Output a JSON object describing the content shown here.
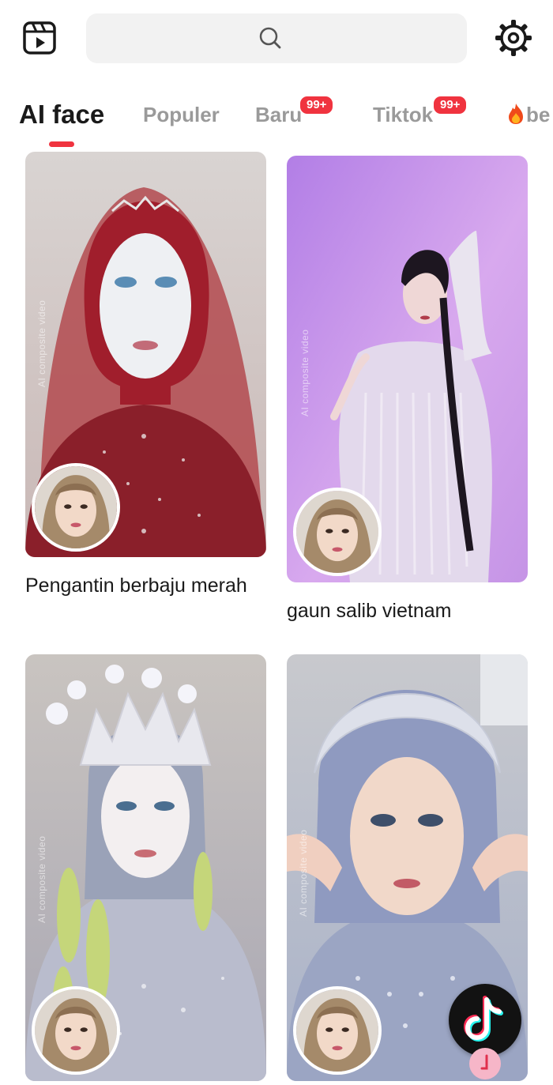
{
  "header": {
    "app_icon": "video-clip-icon",
    "search": {
      "icon": "search-icon"
    },
    "settings_icon": "settings-gear-icon"
  },
  "tabs": [
    {
      "label": "AI face",
      "active": true
    },
    {
      "label": "Populer"
    },
    {
      "label": "Baru",
      "badge": "99+"
    },
    {
      "label": "Tiktok",
      "badge": "99+"
    },
    {
      "label": "be",
      "icon": "flame-icon"
    }
  ],
  "cards": [
    {
      "title": "Pengantin berbaju merah",
      "watermark": "AI composite video",
      "theme": "red-bridal"
    },
    {
      "title": "gaun salib vietnam",
      "watermark": "AI composite video",
      "theme": "purple-dance"
    },
    {
      "title": "",
      "watermark": "AI composite video",
      "theme": "silver-crown"
    },
    {
      "title": "",
      "watermark": "AI composite video",
      "theme": "blue-hijab"
    }
  ],
  "floating": {
    "tiktok_icon": "tiktok-icon"
  },
  "colors": {
    "accent": "#f0333f",
    "search_bg": "#f2f2f2"
  }
}
